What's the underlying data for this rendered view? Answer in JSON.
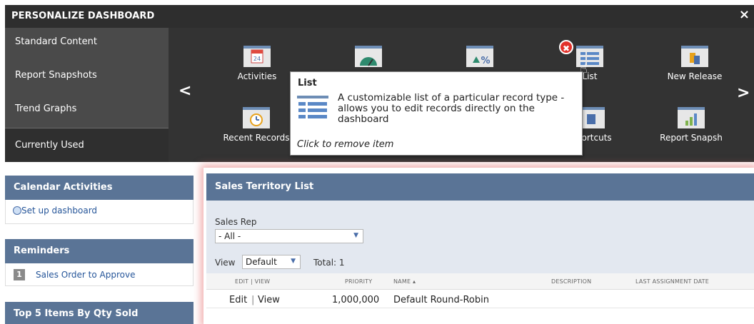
{
  "header": {
    "title": "PERSONALIZE DASHBOARD",
    "close": "×"
  },
  "menu": {
    "items": [
      "Standard Content",
      "Report Snapshots",
      "Trend Graphs",
      "Currently Used"
    ],
    "active_index": 3
  },
  "carousel": {
    "prev": "<",
    "next": ">",
    "tiles": [
      {
        "label": "Activities",
        "icon": "calendar-icon"
      },
      {
        "label": "",
        "icon": "gauge-icon"
      },
      {
        "label": "",
        "icon": "percent-up-icon"
      },
      {
        "label": "List",
        "icon": "list-icon"
      },
      {
        "label": "New Release",
        "icon": "new-release-icon"
      },
      {
        "label": "Recent Records",
        "icon": "recent-records-icon"
      },
      {
        "label": "Shortcuts",
        "icon": "shortcuts-icon"
      },
      {
        "label": "Report Snapsh",
        "icon": "report-snapshot-icon"
      }
    ],
    "remove_badge": "✖"
  },
  "tooltip": {
    "title": "List",
    "description": "A customizable list of a particular record type - allows you to edit records directly on the dashboard",
    "hint": "Click to remove item"
  },
  "calendar": {
    "title": "Calendar Activities",
    "link": "Set up dashboard"
  },
  "reminders": {
    "title": "Reminders",
    "count": "1",
    "item": "Sales Order to Approve"
  },
  "top_items": {
    "title": "Top 5 Items By Qty Sold"
  },
  "sales_list": {
    "title": "Sales Territory List",
    "sales_rep_label": "Sales Rep",
    "sales_rep_value": "- All -",
    "view_label": "View",
    "view_value": "Default",
    "total": "Total: 1",
    "columns": [
      "EDIT | VIEW",
      "PRIORITY",
      "NAME ▴",
      "DESCRIPTION",
      "LAST ASSIGNMENT DATE"
    ],
    "rows": [
      {
        "edit": "Edit",
        "sep": "|",
        "view": "View",
        "priority": "1,000,000",
        "name": "Default Round-Robin",
        "description": "",
        "last_date": ""
      }
    ]
  },
  "colors": {
    "header_bg": "#2e2e2e",
    "portlet_head": "#5a7496",
    "link": "#255599",
    "badge": "#e2312a"
  }
}
